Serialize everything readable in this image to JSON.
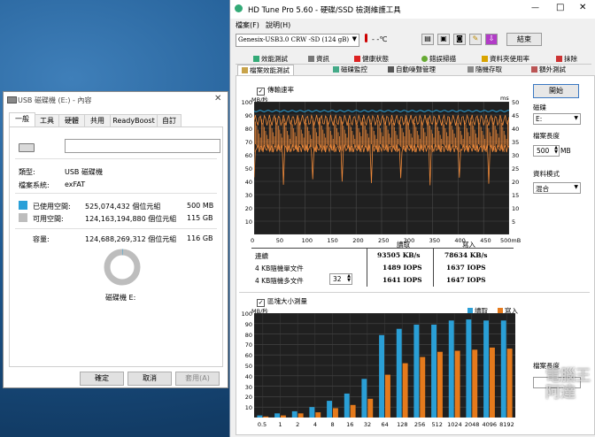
{
  "properties_window": {
    "title": "USB 磁碟機 (E:) - 內容",
    "close": "✕",
    "tabs": [
      "一般",
      "工具",
      "硬體",
      "共用",
      "ReadyBoost",
      "自訂"
    ],
    "active_tab": "一般",
    "name_value": "",
    "type_label": "類型:",
    "type_value": "USB 磁碟機",
    "fs_label": "檔案系統:",
    "fs_value": "exFAT",
    "used_label": "已使用空間:",
    "used_bytes": "525,074,432 個位元組",
    "used_short": "500 MB",
    "free_label": "可用空間:",
    "free_bytes": "124,163,194,880 個位元組",
    "free_short": "115 GB",
    "cap_label": "容量:",
    "cap_bytes": "124,688,269,312 個位元組",
    "cap_short": "116 GB",
    "drive_label": "磁碟機 E:",
    "used_fraction": 0.0042,
    "colors": {
      "used": "#2aa0d8",
      "free": "#bdbdbd"
    },
    "buttons": {
      "ok": "確定",
      "cancel": "取消",
      "apply": "套用(A)"
    }
  },
  "hdtune": {
    "title": "HD Tune Pro 5.60 - 硬碟/SSD 檢測維護工具",
    "win_controls": {
      "min": "—",
      "max": "□",
      "close": "✕"
    },
    "menu": {
      "file": "檔案(F)",
      "help": "說明(H)"
    },
    "drive_select": "Genesix-USB3.0 CRW  -SD (124 gB)",
    "temp": "- -℃",
    "exit_button": "結束",
    "tabs_row1": [
      "效能測試",
      "資訊",
      "健康狀態",
      "錯誤掃描",
      "資料夾使用率",
      "抹除"
    ],
    "tabs_row2": [
      "檔案效能測試",
      "磁碟監控",
      "自動噪聲管理",
      "隨機存取",
      "額外測試"
    ],
    "transfer": {
      "checkbox_label": "傳輸速率",
      "unit_left": "MB/秒",
      "unit_right": "ms",
      "y_left": [
        "100",
        "90",
        "80",
        "70",
        "60",
        "50",
        "40",
        "30",
        "20",
        "10"
      ],
      "y_right": [
        "50",
        "45",
        "40",
        "35",
        "30",
        "25",
        "20",
        "15",
        "10",
        "5"
      ],
      "x": [
        "0",
        "50",
        "100",
        "150",
        "200",
        "250",
        "300",
        "350",
        "400",
        "450",
        "500mB"
      ]
    },
    "results": {
      "col_read": "讀取",
      "col_write": "寫入",
      "row_seq": "連續",
      "seq_read": "93505 KB/s",
      "seq_write": "78634 KB/s",
      "row_4k_single": "4 KB隨機單文件",
      "k4s_read": "1489 IOPS",
      "k4s_write": "1637 IOPS",
      "row_4k_multi": "4 KB隨機多文件",
      "k4m_read": "1641 IOPS",
      "k4m_write": "1647 IOPS",
      "queue_depth": "32"
    },
    "side": {
      "start_button": "開始",
      "drive_label": "磁碟",
      "drive_value": "E:",
      "file_length_label": "檔案長度",
      "file_length_value": "500",
      "file_length_unit": "MB",
      "pattern_label": "資料模式",
      "pattern_value": "混合",
      "file_length_label2": "檔案長度"
    },
    "block": {
      "checkbox_label": "區塊大小測量",
      "unit": "MB/秒",
      "legend_read": "讀取",
      "legend_write": "寫入",
      "y": [
        "100",
        "90",
        "80",
        "70",
        "60",
        "50",
        "40",
        "30",
        "20",
        "10"
      ]
    },
    "colors": {
      "read": "#2a9fd6",
      "write": "#e57a1c",
      "line": "#f08a3a",
      "chart_bg": "#202020"
    }
  },
  "watermark": "電腦王阿達",
  "chart_data": {
    "type": "bar",
    "categories": [
      "0.5",
      "1",
      "2",
      "4",
      "8",
      "16",
      "32",
      "64",
      "128",
      "256",
      "512",
      "1024",
      "2048",
      "4096",
      "8192"
    ],
    "series": [
      {
        "name": "讀取",
        "values": [
          2,
          4,
          6,
          10,
          16,
          23,
          37,
          79,
          85,
          89,
          89,
          93,
          94,
          93,
          93
        ]
      },
      {
        "name": "寫入",
        "values": [
          1,
          2,
          4,
          5,
          9,
          12,
          18,
          41,
          52,
          58,
          63,
          64,
          65,
          67,
          66
        ]
      }
    ],
    "xlabel": "",
    "ylabel": "MB/秒",
    "ylim": [
      0,
      100
    ]
  }
}
